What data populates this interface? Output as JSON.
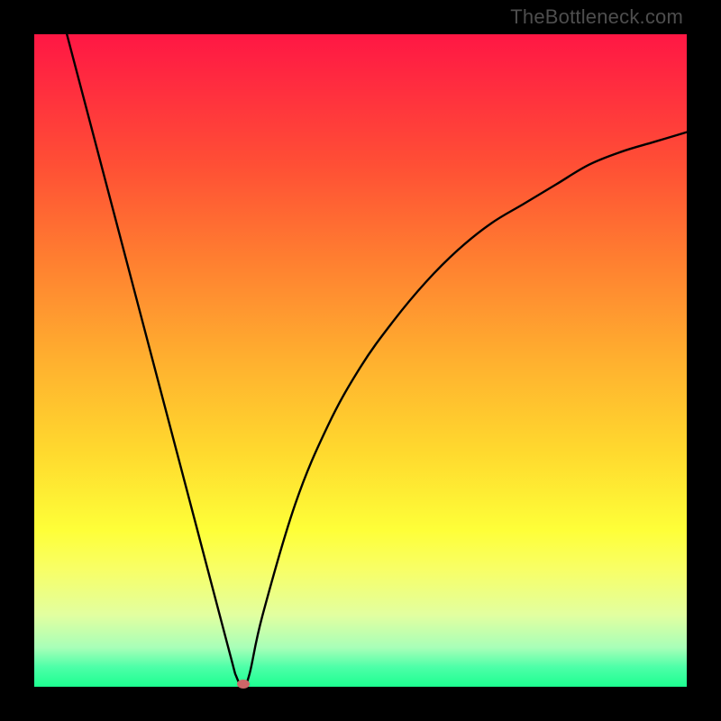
{
  "watermark": "TheBottleneck.com",
  "chart_data": {
    "type": "line",
    "title": "",
    "xlabel": "",
    "ylabel": "",
    "xlim": [
      0,
      100
    ],
    "ylim": [
      0,
      100
    ],
    "grid": false,
    "legend": false,
    "series": [
      {
        "name": "curve",
        "x": [
          5,
          10,
          15,
          20,
          25,
          30,
          31,
          32,
          33,
          35,
          40,
          45,
          50,
          55,
          60,
          65,
          70,
          75,
          80,
          85,
          90,
          95,
          100
        ],
        "y": [
          100,
          81,
          62,
          43,
          24,
          5,
          1.5,
          0,
          2,
          11,
          28,
          40,
          49,
          56,
          62,
          67,
          71,
          74,
          77,
          80,
          82,
          83.5,
          85
        ]
      }
    ],
    "marker": {
      "x": 32,
      "y": 0.4
    }
  },
  "colors": {
    "background": "#000000",
    "curve": "#000000",
    "marker": "#cd6668"
  }
}
